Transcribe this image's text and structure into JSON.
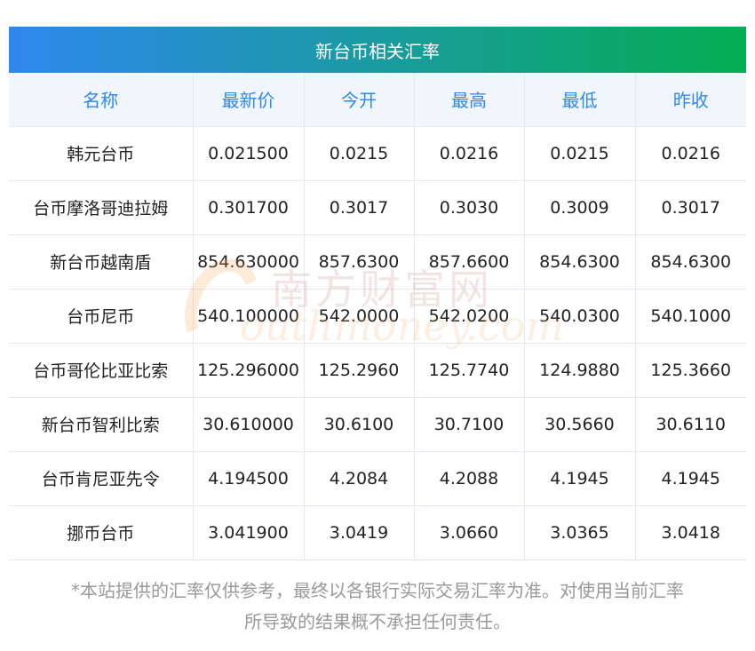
{
  "title": "新台币相关汇率",
  "columns": [
    "名称",
    "最新价",
    "今开",
    "最高",
    "最低",
    "昨收"
  ],
  "rows": [
    [
      "韩元台币",
      "0.021500",
      "0.0215",
      "0.0216",
      "0.0215",
      "0.0216"
    ],
    [
      "台币摩洛哥迪拉姆",
      "0.301700",
      "0.3017",
      "0.3030",
      "0.3009",
      "0.3017"
    ],
    [
      "新台币越南盾",
      "854.630000",
      "857.6300",
      "857.6600",
      "854.6300",
      "854.6300"
    ],
    [
      "台币尼币",
      "540.100000",
      "542.0000",
      "542.0200",
      "540.0300",
      "540.1000"
    ],
    [
      "台币哥伦比亚比索",
      "125.296000",
      "125.2960",
      "125.7740",
      "124.9880",
      "125.3660"
    ],
    [
      "新台币智利比索",
      "30.610000",
      "30.6100",
      "30.7100",
      "30.5660",
      "30.6110"
    ],
    [
      "台币肯尼亚先令",
      "4.194500",
      "4.2084",
      "4.2088",
      "4.1945",
      "4.1945"
    ],
    [
      "挪币台币",
      "3.041900",
      "3.0419",
      "3.0660",
      "3.0365",
      "3.0418"
    ]
  ],
  "watermark": {
    "cn": "南方财富网",
    "en": "outhmoney.com"
  },
  "note_line1": "*本站提供的汇率仅供参考，最终以各银行实际交易汇率为准。对使用当前汇率",
  "note_line2": "所导致的结果概不承担任何责任。",
  "colors": {
    "gradient_start": "#2f88ee",
    "gradient_end": "#04ae52",
    "header_text": "#2f88ee"
  }
}
